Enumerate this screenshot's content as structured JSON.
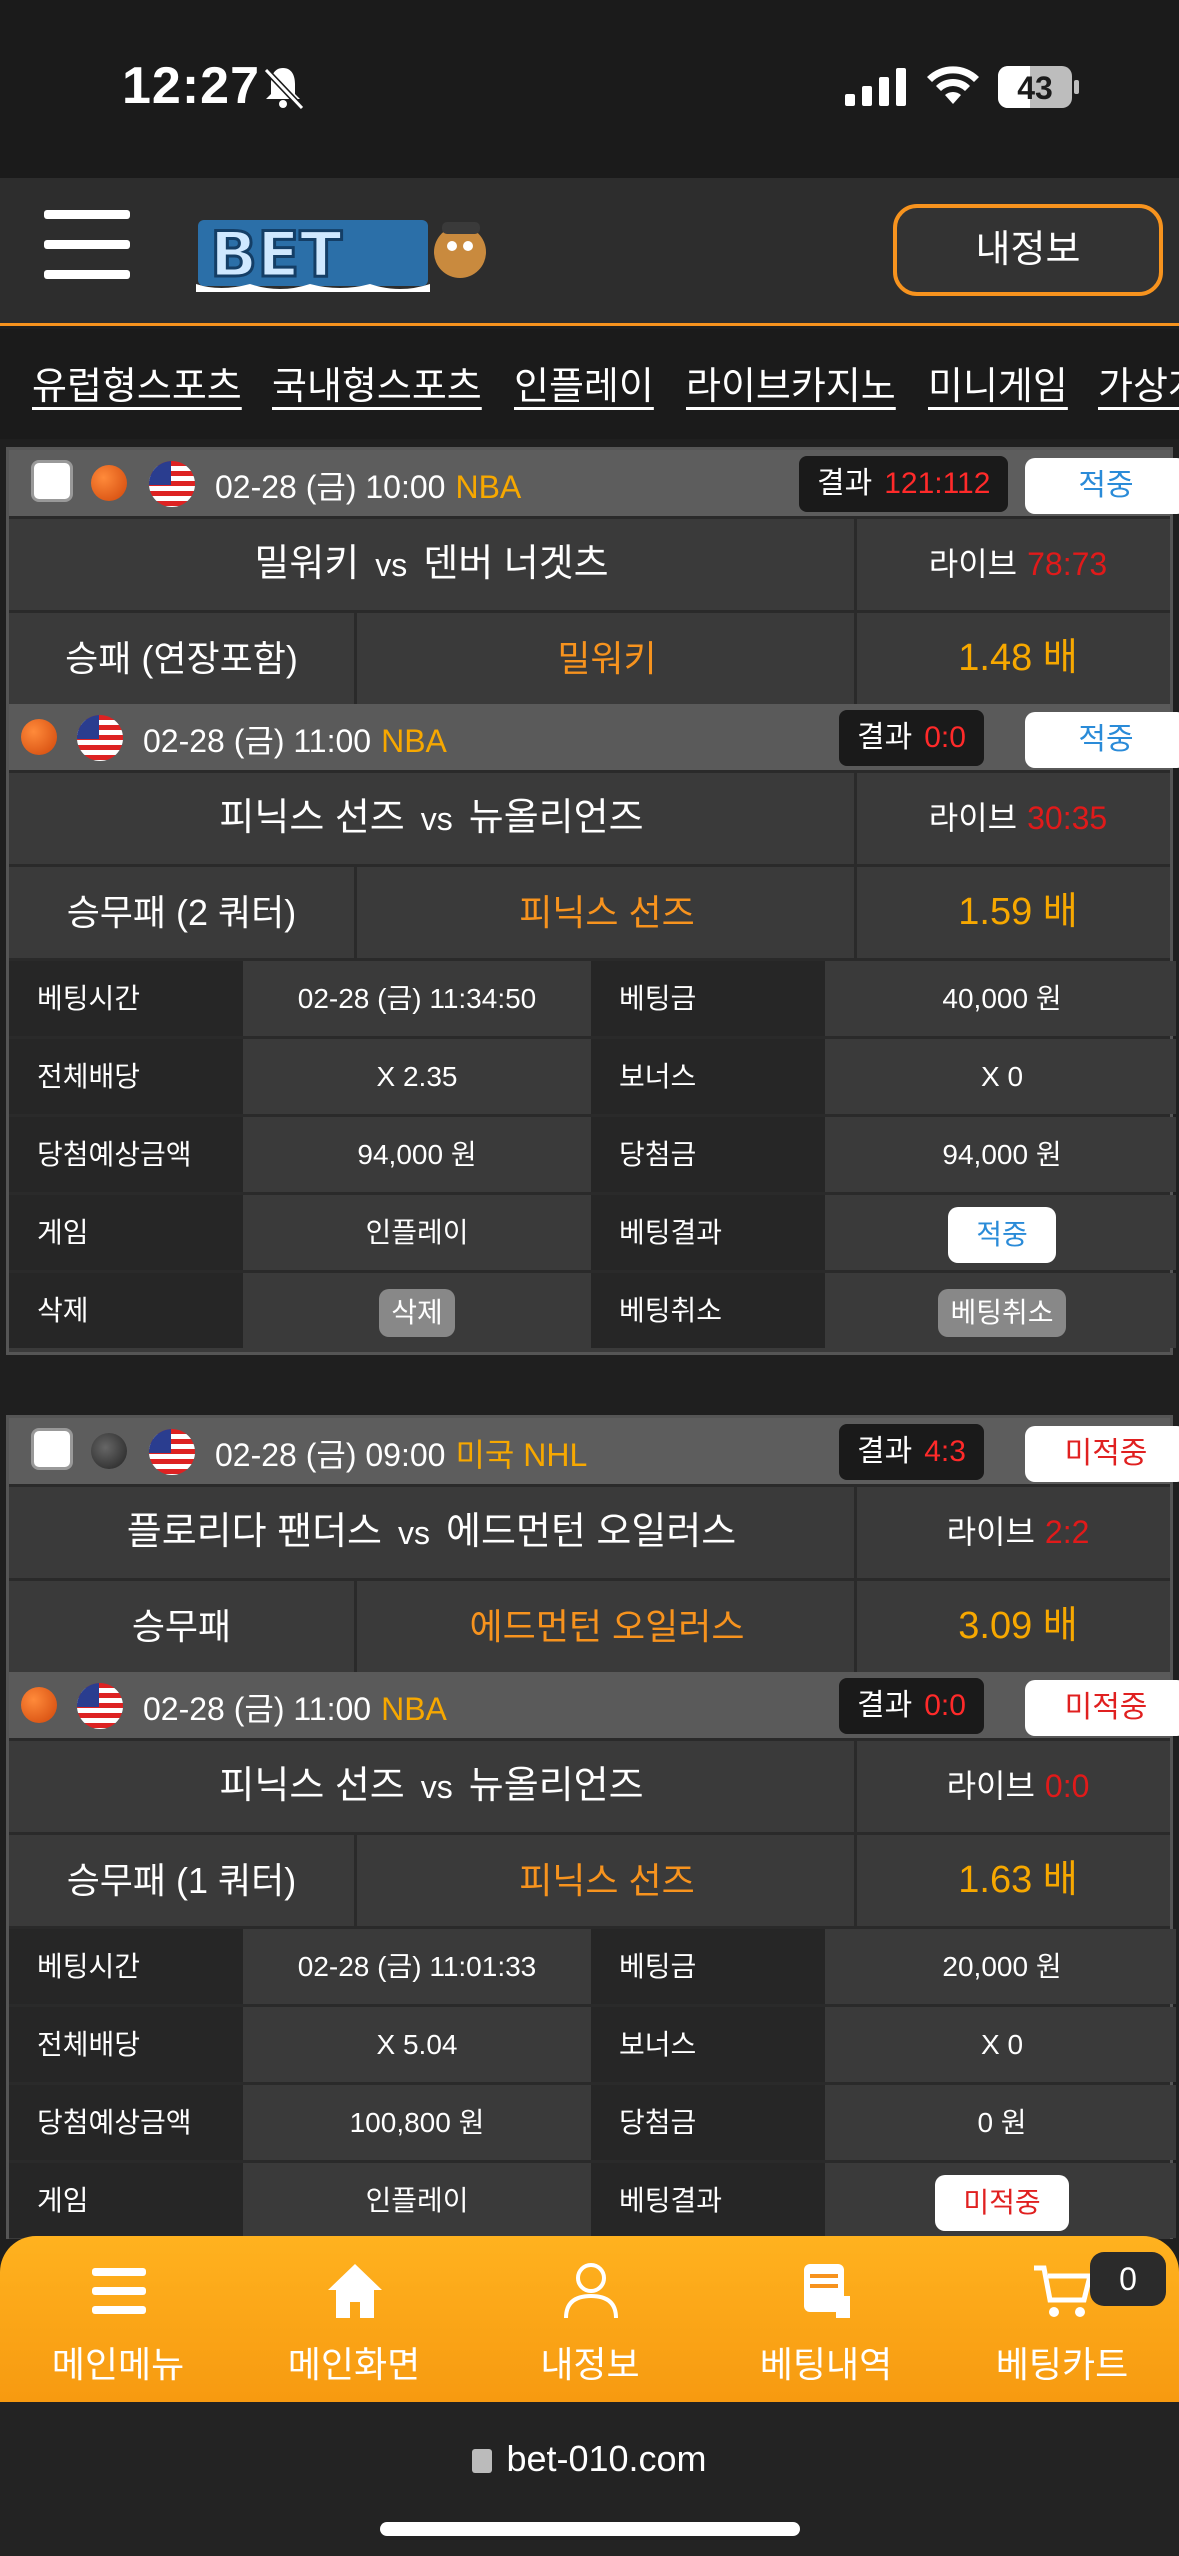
{
  "status": {
    "time": "12:27",
    "battery": "43"
  },
  "header": {
    "myinfo": "내정보",
    "logo_text": "BET"
  },
  "tabs": [
    "유럽형스포츠",
    "국내형스포츠",
    "인플레이",
    "라이브카지노",
    "미니게임",
    "가상게임"
  ],
  "labels": {
    "vs": "vs",
    "live": "라이브",
    "result": "결과",
    "odds_suffix": "배"
  },
  "bet1": {
    "m1": {
      "date": "02-28 (금) 10:00",
      "league": "NBA",
      "score": "121:112",
      "status": "적중",
      "home": "밀워키",
      "away": "덴버 너겟츠",
      "live": "78:73",
      "market": "승패 (연장포함)",
      "pick": "밀워키",
      "odds": "1.48 배"
    },
    "m2": {
      "date": "02-28 (금) 11:00",
      "league": "NBA",
      "score": "0:0",
      "status": "적중",
      "home": "피닉스 선즈",
      "away": "뉴올리언즈",
      "live": "30:35",
      "market": "승무패 (2 쿼터)",
      "pick": "피닉스 선즈",
      "odds": "1.59 배"
    },
    "details": {
      "bet_time_label": "베팅시간",
      "bet_time": "02-28 (금) 11:34:50",
      "bet_amount_label": "베팅금",
      "bet_amount": "40,000 원",
      "total_odds_label": "전체배당",
      "total_odds": "X 2.35",
      "bonus_label": "보너스",
      "bonus": "X 0",
      "expected_label": "당첨예상금액",
      "expected": "94,000 원",
      "win_label": "당첨금",
      "win": "94,000 원",
      "game_label": "게임",
      "game": "인플레이",
      "result_label": "베팅결과",
      "result": "적중",
      "delete_label": "삭제",
      "delete_btn": "삭제",
      "cancel_label": "베팅취소",
      "cancel_btn": "베팅취소"
    }
  },
  "bet2": {
    "m1": {
      "date": "02-28 (금) 09:00",
      "league": "미국 NHL",
      "score": "4:3",
      "status": "미적중",
      "home": "플로리다 팬더스",
      "away": "에드먼턴 오일러스",
      "live": "2:2",
      "market": "승무패",
      "pick": "에드먼턴 오일러스",
      "odds": "3.09 배"
    },
    "m2": {
      "date": "02-28 (금) 11:00",
      "league": "NBA",
      "score": "0:0",
      "status": "미적중",
      "home": "피닉스 선즈",
      "away": "뉴올리언즈",
      "live": "0:0",
      "market": "승무패 (1 쿼터)",
      "pick": "피닉스 선즈",
      "odds": "1.63 배"
    },
    "details": {
      "bet_time_label": "베팅시간",
      "bet_time": "02-28 (금) 11:01:33",
      "bet_amount_label": "베팅금",
      "bet_amount": "20,000 원",
      "total_odds_label": "전체배당",
      "total_odds": "X 5.04",
      "bonus_label": "보너스",
      "bonus": "X 0",
      "expected_label": "당첨예상금액",
      "expected": "100,800 원",
      "win_label": "당첨금",
      "win": "0 원",
      "game_label": "게임",
      "game": "인플레이",
      "result_label": "베팅결과",
      "result": "미적중"
    }
  },
  "bottom_menu": [
    "메인메뉴",
    "메인화면",
    "내정보",
    "베팅내역",
    "베팅카트"
  ],
  "cart_count": "0",
  "url": "bet-010.com",
  "colors": {
    "accent": "#f7931e",
    "win": "#2a8bd8",
    "lose": "#e02020",
    "score": "#ff2a2a"
  }
}
